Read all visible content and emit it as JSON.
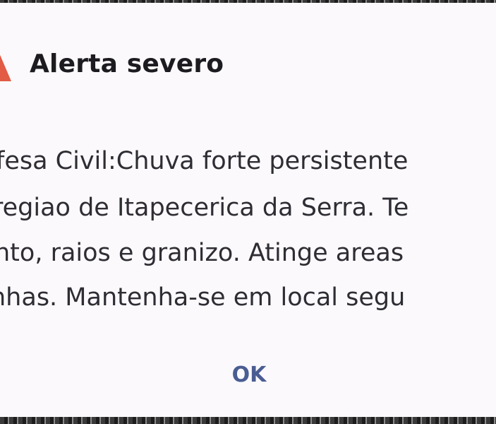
{
  "dialog": {
    "title": "Alerta severo",
    "icon": "warning-triangle-icon",
    "accent_color": "#e25b45",
    "body_lines": [
      "fesa Civil:Chuva forte persistente",
      "regiao de Itapecerica da Serra. Te",
      "nto, raios e granizo. Atinge areas",
      "nhas. Mantenha-se em local segu"
    ],
    "ok_label": "OK"
  }
}
